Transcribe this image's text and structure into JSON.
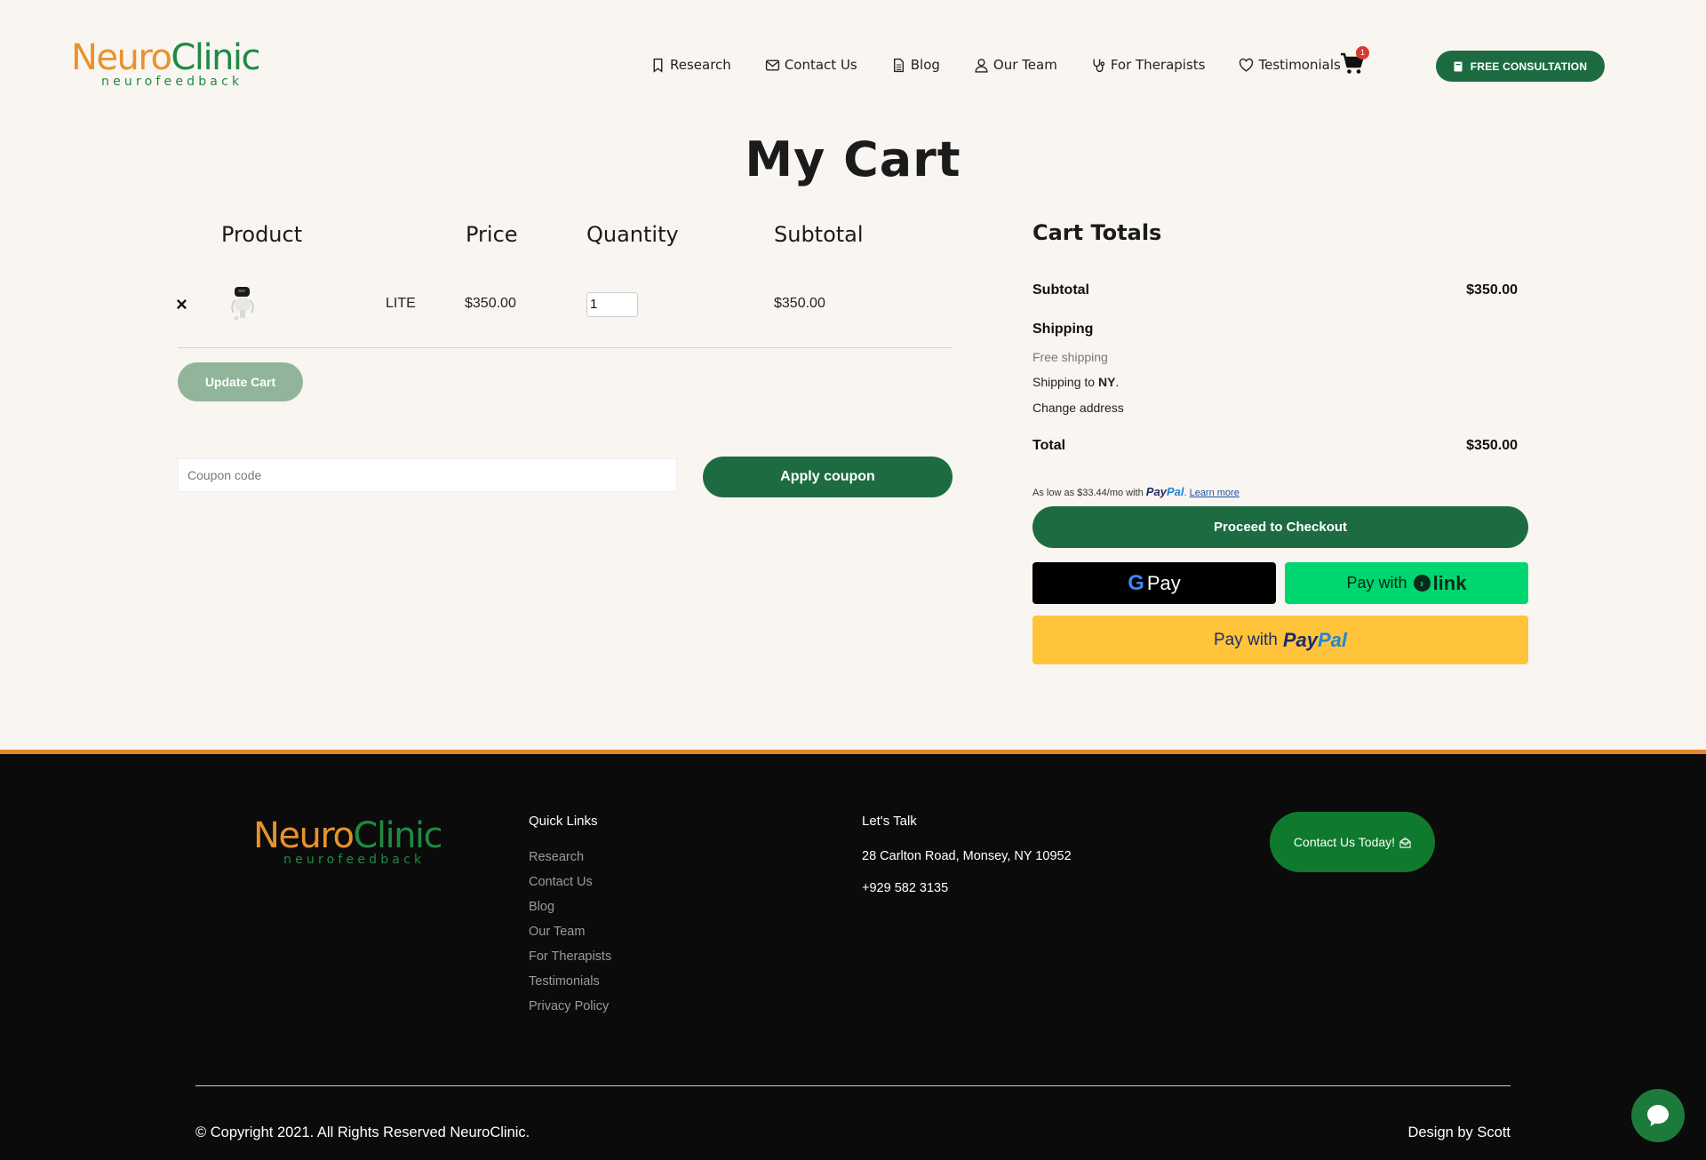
{
  "brand": {
    "name_part1": "Neuro",
    "name_part2": "Clinic",
    "tagline": "neurofeedback",
    "colors": {
      "orange": "#e8922d",
      "green": "#1f8a44",
      "dark_green": "#1d6c41"
    }
  },
  "nav": {
    "items": [
      {
        "label": "Research",
        "icon": "bookmark-icon"
      },
      {
        "label": "Contact Us",
        "icon": "envelope-icon"
      },
      {
        "label": "Blog",
        "icon": "document-icon"
      },
      {
        "label": "Our Team",
        "icon": "user-icon"
      },
      {
        "label": "For Therapists",
        "icon": "stethoscope-icon"
      },
      {
        "label": "Testimonials",
        "icon": "heart-icon"
      }
    ],
    "cart_count": "1",
    "consultation_label": "FREE CONSULTATION"
  },
  "page": {
    "title": "My Cart"
  },
  "cart": {
    "headers": {
      "product": "Product",
      "price": "Price",
      "quantity": "Quantity",
      "subtotal": "Subtotal"
    },
    "remove_glyph": "×",
    "item": {
      "name": "LITE",
      "price": "$350.00",
      "quantity": "1",
      "subtotal": "$350.00"
    },
    "update_label": "Update Cart",
    "coupon_placeholder": "Coupon code",
    "apply_label": "Apply coupon"
  },
  "totals": {
    "title": "Cart Totals",
    "subtotal_label": "Subtotal",
    "subtotal_value": "$350.00",
    "shipping_label": "Shipping",
    "free_shipping": "Free shipping",
    "shipping_to_prefix": "Shipping to ",
    "shipping_to_state": "NY",
    "shipping_to_suffix": ".",
    "change_address": "Change address",
    "total_label": "Total",
    "total_value": "$350.00",
    "paypal_msg_prefix": "As low as $33.44/mo with",
    "paypal_brand_a": "Pay",
    "paypal_brand_b": "Pal",
    "paypal_msg_dot": ".",
    "learn_more": "Learn more",
    "checkout_label": "Proceed to Checkout",
    "gpay_g": "G",
    "gpay_label": "Pay",
    "link_prefix": "Pay with",
    "link_arrow": "›",
    "link_label": "link",
    "paypal_btn_prefix": "Pay with",
    "paypal_btn_a": "Pay",
    "paypal_btn_b": "Pal"
  },
  "footer": {
    "quick_links_title": "Quick Links",
    "quick_links": [
      "Research",
      "Contact Us",
      "Blog",
      "Our Team",
      "For Therapists",
      "Testimonials",
      "Privacy Policy"
    ],
    "lets_talk_title": "Let's Talk",
    "address": "28 Carlton Road, Monsey, NY 10952",
    "phone": "+929 582 3135",
    "contact_btn": "Contact Us Today!",
    "copyright": "© Copyright 2021. All Rights Reserved NeuroClinic.",
    "design_by": "Design by Scott",
    "accent": "#e8862a"
  }
}
